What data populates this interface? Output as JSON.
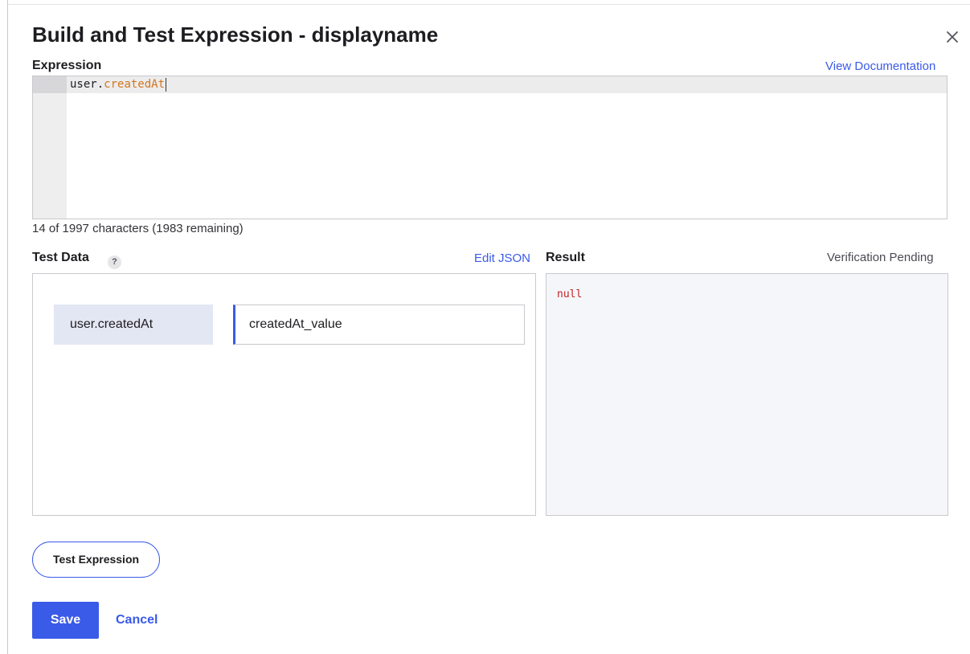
{
  "dialog": {
    "title": "Build and Test Expression - displayname",
    "close_icon": "close-icon"
  },
  "expression": {
    "label": "Expression",
    "doc_link": "View Documentation",
    "code_object": "user.",
    "code_property": "createdAt",
    "counter": "14 of 1997 characters (1983 remaining)"
  },
  "test_data": {
    "label": "Test Data",
    "help_glyph": "?",
    "edit_link": "Edit JSON",
    "rows": [
      {
        "name": "user.createdAt",
        "value": "createdAt_value"
      }
    ]
  },
  "result": {
    "label": "Result",
    "status": "Verification Pending",
    "value": "null"
  },
  "actions": {
    "test": "Test Expression",
    "save": "Save",
    "cancel": "Cancel"
  },
  "colors": {
    "accent": "#3a5ae8",
    "property_token": "#d4761b",
    "result_null": "#c12222"
  }
}
